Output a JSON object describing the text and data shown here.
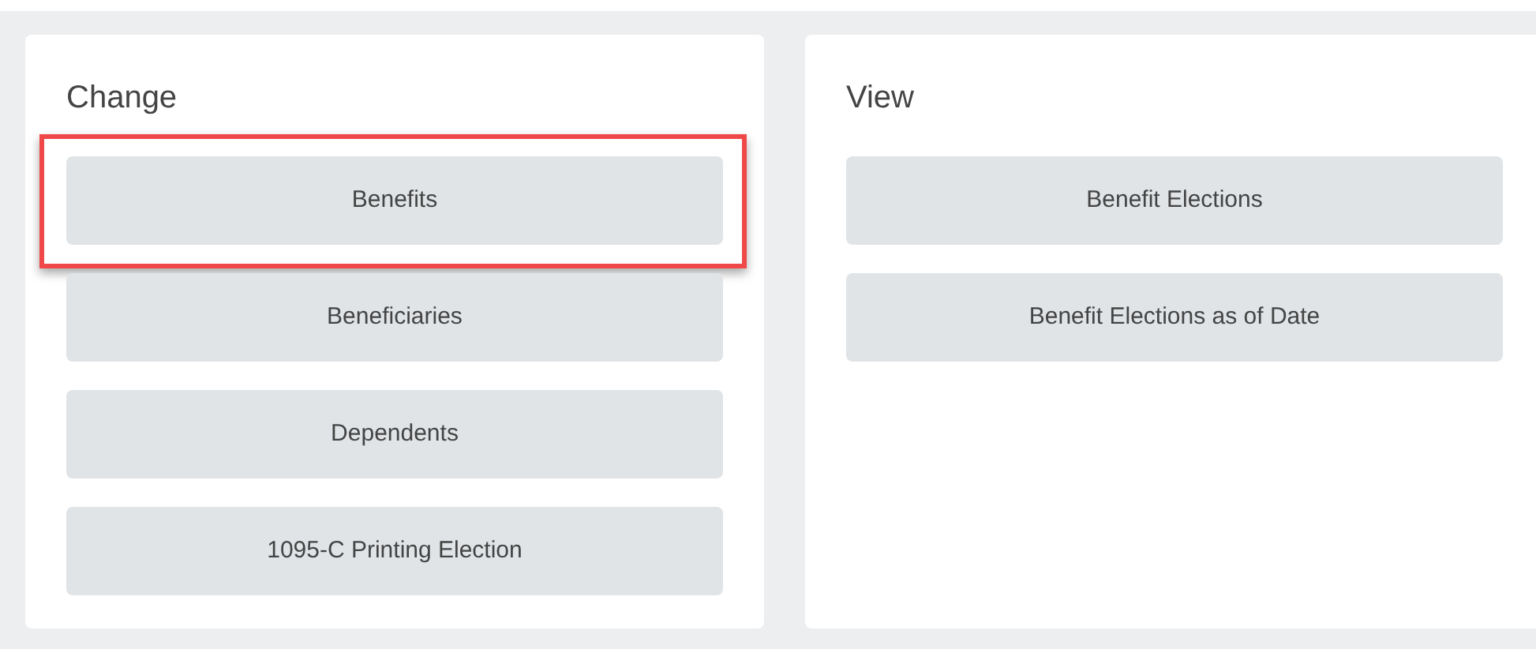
{
  "panels": [
    {
      "title": "Change",
      "buttons": [
        {
          "label": "Benefits",
          "highlighted": true
        },
        {
          "label": "Beneficiaries",
          "highlighted": false
        },
        {
          "label": "Dependents",
          "highlighted": false
        },
        {
          "label": "1095-C Printing Election",
          "highlighted": false
        }
      ]
    },
    {
      "title": "View",
      "buttons": [
        {
          "label": "Benefit Elections",
          "highlighted": false
        },
        {
          "label": "Benefit Elections as of Date",
          "highlighted": false
        }
      ]
    }
  ]
}
